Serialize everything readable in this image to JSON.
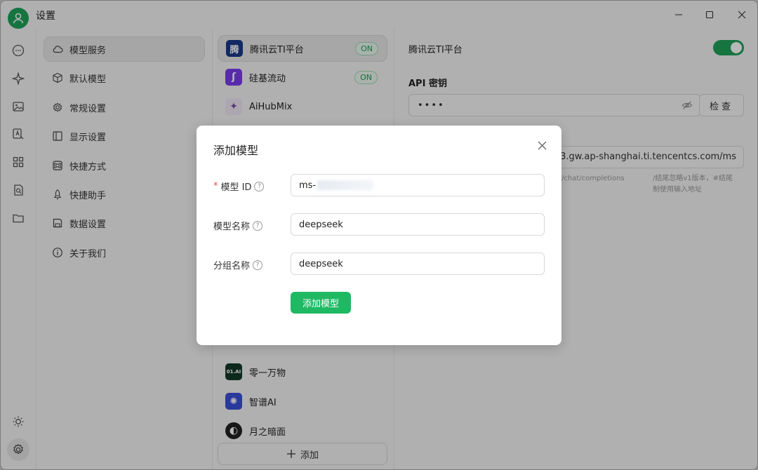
{
  "app": {
    "title": "设置"
  },
  "rail": {
    "icons": [
      "chat-icon",
      "sparkle-icon",
      "image-icon",
      "translate-icon",
      "apps-icon",
      "file-search-icon",
      "folder-icon"
    ],
    "bottom": [
      "brightness-icon",
      "settings-icon"
    ]
  },
  "menu": {
    "items": [
      {
        "label": "模型服务",
        "icon": "cloud-icon",
        "active": true
      },
      {
        "label": "默认模型",
        "icon": "cube-icon"
      },
      {
        "label": "常规设置",
        "icon": "gear-icon"
      },
      {
        "label": "显示设置",
        "icon": "layout-icon"
      },
      {
        "label": "快捷方式",
        "icon": "command-icon"
      },
      {
        "label": "快捷助手",
        "icon": "rocket-icon"
      },
      {
        "label": "数据设置",
        "icon": "save-icon"
      },
      {
        "label": "关于我们",
        "icon": "info-icon"
      }
    ]
  },
  "providers": {
    "items": [
      {
        "name": "腾讯云TI平台",
        "logo": "腾",
        "logo_color": "#1b3a8a",
        "badge": "ON"
      },
      {
        "name": "硅基流动",
        "logo": "ʃ",
        "logo_color": "#7a3cf0",
        "badge": "ON"
      },
      {
        "name": "AiHubMix",
        "logo": "✦",
        "logo_color": "#e8e0f0"
      },
      {
        "name": "零一万物",
        "logo": "01.AI",
        "logo_color": "#123a2a"
      },
      {
        "name": "智谱AI",
        "logo": "✺",
        "logo_color": "#3a4fd8"
      },
      {
        "name": "月之暗面",
        "logo": "◐",
        "logo_color": "#222222"
      }
    ],
    "add_label": "添加"
  },
  "detail": {
    "title": "腾讯云TI平台",
    "enabled": true,
    "api_key_label": "API 密钥",
    "api_key_value": "••••",
    "check_label": "检查",
    "api_url_value": "233.gw.ap-shanghai.ti.tencentcs.com/ms",
    "hint_left_1": "",
    "hint_left_2": "/chat/completions",
    "hint_right_1": "/结尾忽略v1版本，#结尾",
    "hint_right_2": "制使用输入地址"
  },
  "modal": {
    "title": "添加模型",
    "model_id_label": "模型 ID",
    "model_id_value": "ms-",
    "model_name_label": "模型名称",
    "model_name_value": "deepseek",
    "group_name_label": "分组名称",
    "group_name_value": "deepseek",
    "submit_label": "添加模型",
    "required_mark": "*",
    "help_mark": "?"
  },
  "colors": {
    "accent": "#1fb964",
    "toggle": "#1fa15a",
    "avatar": "#1fa15a"
  }
}
